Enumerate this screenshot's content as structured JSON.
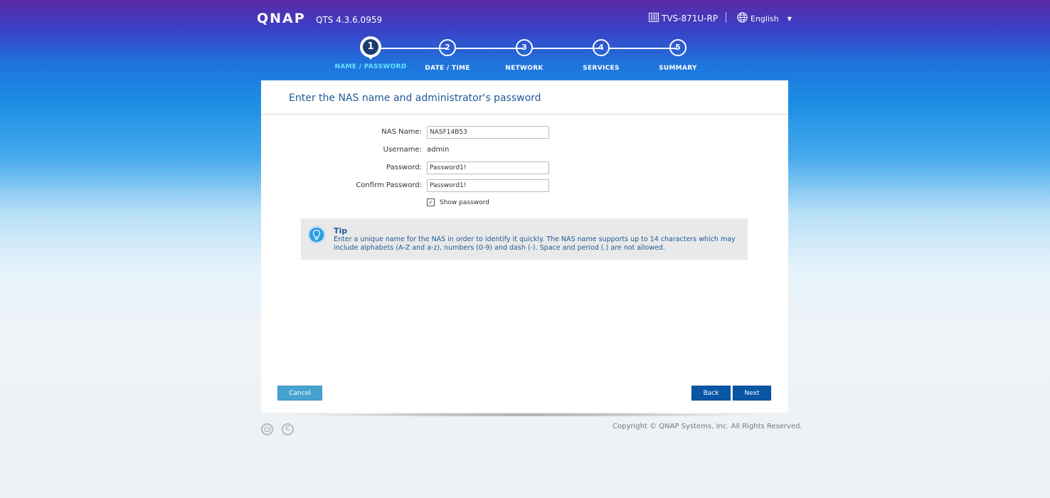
{
  "header": {
    "logo": "QNAP",
    "version": "QTS 4.3.6.0959",
    "device_name": "TVS-871U-RP",
    "language": "English",
    "icons": {
      "device": "nas-device-icon",
      "language": "globe-icon",
      "dropdown": "caret-down-icon"
    }
  },
  "steps": [
    {
      "number": "1",
      "label": "NAME / PASSWORD",
      "active": true
    },
    {
      "number": "2",
      "label": "DATE / TIME",
      "active": false
    },
    {
      "number": "3",
      "label": "NETWORK",
      "active": false
    },
    {
      "number": "4",
      "label": "SERVICES",
      "active": false
    },
    {
      "number": "5",
      "label": "SUMMARY",
      "active": false
    }
  ],
  "panel": {
    "title": "Enter the NAS name and administrator's password"
  },
  "form": {
    "nas_name_label": "NAS Name:",
    "nas_name_value": "NASF14B53",
    "username_label": "Username:",
    "username_value": "admin",
    "password_label": "Password:",
    "password_value": "Password1!",
    "confirm_label": "Confirm Password:",
    "confirm_value": "Password1!",
    "show_password_label": "Show password",
    "show_password_checked": true
  },
  "tip": {
    "title": "Tip",
    "text": "Enter a unique name for the NAS in order to identify it quickly. The NAS name supports up to 14 characters which may include alphabets (A-Z and a-z), numbers (0-9) and dash (-). Space and period (.) are not allowed."
  },
  "buttons": {
    "cancel": "Cancel",
    "back": "Back",
    "next": "Next"
  },
  "footer": {
    "copyright": "Copyright © QNAP Systems, Inc. All Rights Reserved.",
    "icons": [
      "power-icon",
      "copyright-c-icon"
    ]
  },
  "colors": {
    "accent": "#0956a5",
    "active_step": "#66e3ff",
    "title_blue": "#1e5a96",
    "cancel_button": "#46a3cf"
  }
}
